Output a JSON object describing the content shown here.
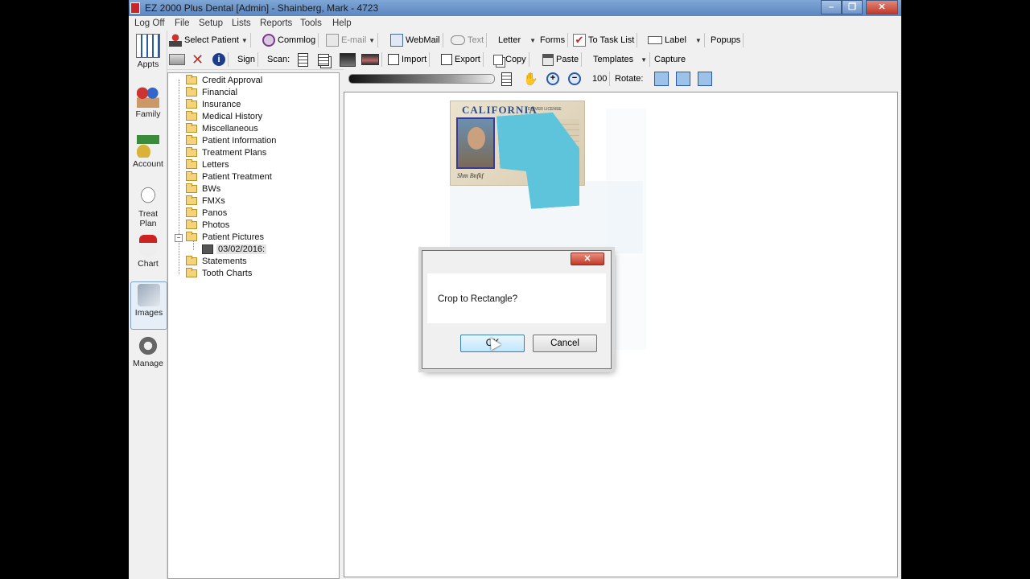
{
  "window": {
    "title": "EZ 2000 Plus Dental [Admin] - Shainberg, Mark - 4723"
  },
  "menu": [
    "Log Off",
    "File",
    "Setup",
    "Lists",
    "Reports",
    "Tools",
    "Help"
  ],
  "toolbar1": {
    "select_patient": "Select Patient",
    "commlog": "Commlog",
    "email": "E-mail",
    "webmail": "WebMail",
    "text": "Text",
    "letter": "Letter",
    "forms": "Forms",
    "to_task_list": "To Task List",
    "label": "Label",
    "popups": "Popups"
  },
  "toolbar2": {
    "sign": "Sign",
    "scan": "Scan:",
    "import": "Import",
    "export": "Export",
    "copy": "Copy",
    "paste": "Paste",
    "templates": "Templates",
    "capture": "Capture"
  },
  "viewbar": {
    "zoom": "100",
    "rotate": "Rotate:"
  },
  "nav": {
    "appts": "Appts",
    "family": "Family",
    "account": "Account",
    "treat_plan_1": "Treat",
    "treat_plan_2": "Plan",
    "chart": "Chart",
    "images": "Images",
    "manage": "Manage"
  },
  "tree": {
    "folders": [
      "Credit Approval",
      "Financial",
      "Insurance",
      "Medical History",
      "Miscellaneous",
      "Patient Information",
      "Treatment Plans",
      "Letters",
      "Patient Treatment",
      "BWs",
      "FMXs",
      "Panos",
      "Photos",
      "Patient Pictures"
    ],
    "expanded_child": "03/02/2016:",
    "folders_after": [
      "Statements",
      "Tooth Charts"
    ]
  },
  "image": {
    "state_text": "CALIFORNIA",
    "dl_text": "DRIVER LICENSE",
    "signature": "Shm Bnfkf"
  },
  "dialog": {
    "close": "✕",
    "message": "Crop to Rectangle?",
    "ok": "OK",
    "cancel": "Cancel"
  },
  "icons": [
    "app-icon",
    "minimize-icon",
    "maximize-icon",
    "close-icon",
    "patient-icon",
    "commlog-icon",
    "email-icon",
    "webmail-icon",
    "text-icon",
    "task-icon",
    "label-icon",
    "scanner-icon",
    "delete-icon",
    "info-icon",
    "page-icon",
    "pages-icon",
    "photo-icon",
    "xray-icon",
    "import-icon",
    "export-icon",
    "copy-icon",
    "paste-icon",
    "fit-page-icon",
    "hand-icon",
    "zoom-in-icon",
    "zoom-out-icon",
    "rotate-left-icon",
    "rotate-right-icon",
    "flip-icon",
    "folder-icon"
  ],
  "colors": {
    "title_bar": "#6f95c8",
    "close": "#c0392b",
    "folder": "#f4d37a",
    "sticky_note": "#5ec4dc",
    "license": "#e3d8c0"
  }
}
